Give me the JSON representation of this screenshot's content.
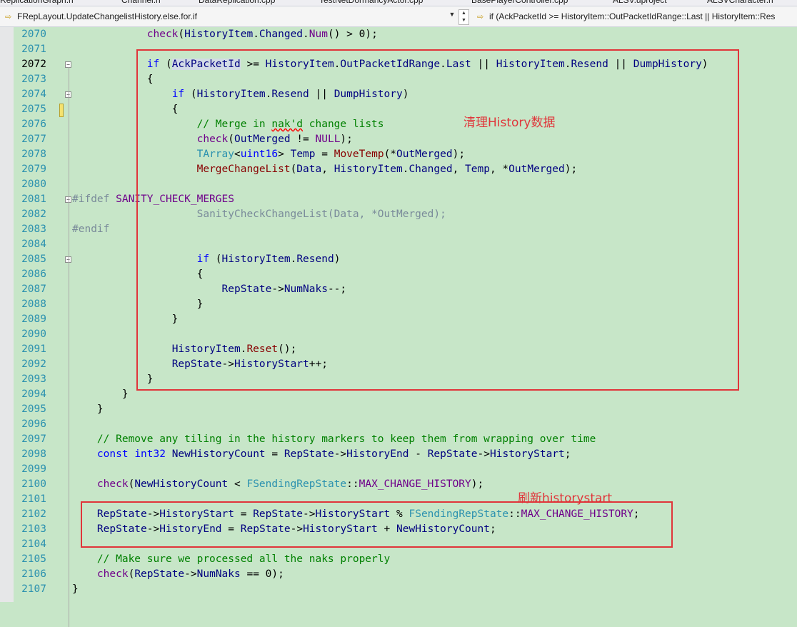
{
  "tabs": [
    "ReplicationGraph.h",
    "Channel.h",
    "DataReplication.cpp",
    "TestNetDormancyActor.cpp",
    "BasePlayerController.cpp",
    "ALSV.uproject",
    "ALSVCharacter.h"
  ],
  "navbar": {
    "scope": "FRepLayout.UpdateChangelistHistory.else.for.if",
    "condition": "if (AckPacketId >= HistoryItem::OutPacketIdRange::Last || HistoryItem::Res"
  },
  "current_line": 2072,
  "code_lines": [
    {
      "n": 2070,
      "tok": [
        [
          "pl",
          "            "
        ],
        [
          "mc",
          "check"
        ],
        [
          "pl",
          "("
        ],
        [
          "vr",
          "HistoryItem"
        ],
        [
          "pl",
          "."
        ],
        [
          "vr",
          "Changed"
        ],
        [
          "pl",
          "."
        ],
        [
          "mc",
          "Num"
        ],
        [
          "pl",
          "() > 0);"
        ]
      ]
    },
    {
      "n": 2071,
      "tok": []
    },
    {
      "n": 2072,
      "tok": [
        [
          "pl",
          "            "
        ],
        [
          "kw",
          "if"
        ],
        [
          "pl",
          " ("
        ],
        [
          "hl",
          "AckPacketId"
        ],
        [
          "pl",
          " >= "
        ],
        [
          "vr",
          "HistoryItem"
        ],
        [
          "pl",
          "."
        ],
        [
          "vr",
          "OutPacketIdRange"
        ],
        [
          "pl",
          "."
        ],
        [
          "vr",
          "Last"
        ],
        [
          "pl",
          " || "
        ],
        [
          "vr",
          "HistoryItem"
        ],
        [
          "pl",
          "."
        ],
        [
          "vr",
          "Resend"
        ],
        [
          "pl",
          " || "
        ],
        [
          "vr",
          "DumpHistory"
        ],
        [
          "pl",
          ")"
        ]
      ]
    },
    {
      "n": 2073,
      "tok": [
        [
          "pl",
          "            {"
        ]
      ]
    },
    {
      "n": 2074,
      "tok": [
        [
          "pl",
          "                "
        ],
        [
          "kw",
          "if"
        ],
        [
          "pl",
          " ("
        ],
        [
          "vr",
          "HistoryItem"
        ],
        [
          "pl",
          "."
        ],
        [
          "vr",
          "Resend"
        ],
        [
          "pl",
          " || "
        ],
        [
          "vr",
          "DumpHistory"
        ],
        [
          "pl",
          ")"
        ]
      ]
    },
    {
      "n": 2075,
      "tok": [
        [
          "pl",
          "                {"
        ]
      ]
    },
    {
      "n": 2076,
      "tok": [
        [
          "pl",
          "                    "
        ],
        [
          "cm",
          "// Merge in "
        ],
        [
          "cmsq",
          "nak'd"
        ],
        [
          "cm",
          " change lists"
        ]
      ]
    },
    {
      "n": 2077,
      "tok": [
        [
          "pl",
          "                    "
        ],
        [
          "mc",
          "check"
        ],
        [
          "pl",
          "("
        ],
        [
          "vr",
          "OutMerged"
        ],
        [
          "pl",
          " != "
        ],
        [
          "mc",
          "NULL"
        ],
        [
          "pl",
          ");"
        ]
      ]
    },
    {
      "n": 2078,
      "tok": [
        [
          "pl",
          "                    "
        ],
        [
          "ty",
          "TArray"
        ],
        [
          "pl",
          "<"
        ],
        [
          "kw",
          "uint16"
        ],
        [
          "pl",
          "> "
        ],
        [
          "vr",
          "Temp"
        ],
        [
          "pl",
          " = "
        ],
        [
          "fn",
          "MoveTemp"
        ],
        [
          "pl",
          "(*"
        ],
        [
          "vr",
          "OutMerged"
        ],
        [
          "pl",
          ");"
        ]
      ]
    },
    {
      "n": 2079,
      "tok": [
        [
          "pl",
          "                    "
        ],
        [
          "fn",
          "MergeChangeList"
        ],
        [
          "pl",
          "("
        ],
        [
          "vr",
          "Data"
        ],
        [
          "pl",
          ", "
        ],
        [
          "vr",
          "HistoryItem"
        ],
        [
          "pl",
          "."
        ],
        [
          "vr",
          "Changed"
        ],
        [
          "pl",
          ", "
        ],
        [
          "vr",
          "Temp"
        ],
        [
          "pl",
          ", *"
        ],
        [
          "vr",
          "OutMerged"
        ],
        [
          "pl",
          ");"
        ]
      ]
    },
    {
      "n": 2080,
      "tok": []
    },
    {
      "n": 2081,
      "tok": [
        [
          "dim",
          "#ifdef "
        ],
        [
          "mc",
          "SANITY_CHECK_MERGES"
        ]
      ]
    },
    {
      "n": 2082,
      "tok": [
        [
          "pl",
          "                    "
        ],
        [
          "dim",
          "SanityCheckChangeList(Data, *OutMerged);"
        ]
      ]
    },
    {
      "n": 2083,
      "tok": [
        [
          "dim",
          "#endif"
        ]
      ]
    },
    {
      "n": 2084,
      "tok": []
    },
    {
      "n": 2085,
      "tok": [
        [
          "pl",
          "                    "
        ],
        [
          "kw",
          "if"
        ],
        [
          "pl",
          " ("
        ],
        [
          "vr",
          "HistoryItem"
        ],
        [
          "pl",
          "."
        ],
        [
          "vr",
          "Resend"
        ],
        [
          "pl",
          ")"
        ]
      ]
    },
    {
      "n": 2086,
      "tok": [
        [
          "pl",
          "                    {"
        ]
      ]
    },
    {
      "n": 2087,
      "tok": [
        [
          "pl",
          "                        "
        ],
        [
          "vr",
          "RepState"
        ],
        [
          "pl",
          "->"
        ],
        [
          "vr",
          "NumNaks"
        ],
        [
          "pl",
          "--;"
        ]
      ]
    },
    {
      "n": 2088,
      "tok": [
        [
          "pl",
          "                    }"
        ]
      ]
    },
    {
      "n": 2089,
      "tok": [
        [
          "pl",
          "                }"
        ]
      ]
    },
    {
      "n": 2090,
      "tok": []
    },
    {
      "n": 2091,
      "tok": [
        [
          "pl",
          "                "
        ],
        [
          "vr",
          "HistoryItem"
        ],
        [
          "pl",
          "."
        ],
        [
          "fn",
          "Reset"
        ],
        [
          "pl",
          "();"
        ]
      ]
    },
    {
      "n": 2092,
      "tok": [
        [
          "pl",
          "                "
        ],
        [
          "vr",
          "RepState"
        ],
        [
          "pl",
          "->"
        ],
        [
          "vr",
          "HistoryStart"
        ],
        [
          "pl",
          "++;"
        ]
      ]
    },
    {
      "n": 2093,
      "tok": [
        [
          "pl",
          "            }"
        ]
      ]
    },
    {
      "n": 2094,
      "tok": [
        [
          "pl",
          "        }"
        ]
      ]
    },
    {
      "n": 2095,
      "tok": [
        [
          "pl",
          "    }"
        ]
      ]
    },
    {
      "n": 2096,
      "tok": []
    },
    {
      "n": 2097,
      "tok": [
        [
          "pl",
          "    "
        ],
        [
          "cm",
          "// Remove any tiling in the history markers to keep them from wrapping over time"
        ]
      ]
    },
    {
      "n": 2098,
      "tok": [
        [
          "pl",
          "    "
        ],
        [
          "kw",
          "const"
        ],
        [
          "pl",
          " "
        ],
        [
          "kw",
          "int32"
        ],
        [
          "pl",
          " "
        ],
        [
          "vr",
          "NewHistoryCount"
        ],
        [
          "pl",
          " = "
        ],
        [
          "vr",
          "RepState"
        ],
        [
          "pl",
          "->"
        ],
        [
          "vr",
          "HistoryEnd"
        ],
        [
          "pl",
          " - "
        ],
        [
          "vr",
          "RepState"
        ],
        [
          "pl",
          "->"
        ],
        [
          "vr",
          "HistoryStart"
        ],
        [
          "pl",
          ";"
        ]
      ]
    },
    {
      "n": 2099,
      "tok": []
    },
    {
      "n": 2100,
      "tok": [
        [
          "pl",
          "    "
        ],
        [
          "mc",
          "check"
        ],
        [
          "pl",
          "("
        ],
        [
          "vr",
          "NewHistoryCount"
        ],
        [
          "pl",
          " < "
        ],
        [
          "ty",
          "FSendingRepState"
        ],
        [
          "pl",
          "::"
        ],
        [
          "mc",
          "MAX_CHANGE_HISTORY"
        ],
        [
          "pl",
          ");"
        ]
      ]
    },
    {
      "n": 2101,
      "tok": []
    },
    {
      "n": 2102,
      "tok": [
        [
          "pl",
          "    "
        ],
        [
          "vr",
          "RepState"
        ],
        [
          "pl",
          "->"
        ],
        [
          "vr",
          "HistoryStart"
        ],
        [
          "pl",
          " = "
        ],
        [
          "vr",
          "RepState"
        ],
        [
          "pl",
          "->"
        ],
        [
          "vr",
          "HistoryStart"
        ],
        [
          "pl",
          " % "
        ],
        [
          "ty",
          "FSendingRepState"
        ],
        [
          "pl",
          "::"
        ],
        [
          "mc",
          "MAX_CHANGE_HISTORY"
        ],
        [
          "pl",
          ";"
        ]
      ]
    },
    {
      "n": 2103,
      "tok": [
        [
          "pl",
          "    "
        ],
        [
          "vr",
          "RepState"
        ],
        [
          "pl",
          "->"
        ],
        [
          "vr",
          "HistoryEnd"
        ],
        [
          "pl",
          " = "
        ],
        [
          "vr",
          "RepState"
        ],
        [
          "pl",
          "->"
        ],
        [
          "vr",
          "HistoryStart"
        ],
        [
          "pl",
          " + "
        ],
        [
          "vr",
          "NewHistoryCount"
        ],
        [
          "pl",
          ";"
        ]
      ]
    },
    {
      "n": 2104,
      "tok": []
    },
    {
      "n": 2105,
      "tok": [
        [
          "pl",
          "    "
        ],
        [
          "cm",
          "// Make sure we processed all the naks properly"
        ]
      ]
    },
    {
      "n": 2106,
      "tok": [
        [
          "pl",
          "    "
        ],
        [
          "mc",
          "check"
        ],
        [
          "pl",
          "("
        ],
        [
          "vr",
          "RepState"
        ],
        [
          "pl",
          "->"
        ],
        [
          "vr",
          "NumNaks"
        ],
        [
          "pl",
          " == 0);"
        ]
      ]
    },
    {
      "n": 2107,
      "tok": [
        [
          "pl",
          "}"
        ]
      ]
    }
  ],
  "annotations": {
    "box1_label": "清理History数据",
    "box2_label": "刷新historystart"
  },
  "colors": {
    "background": "#c7e6c8",
    "keyword": "#0000ff",
    "comment": "#008000",
    "macro": "#6f008a",
    "annotation": "#e0353a"
  }
}
